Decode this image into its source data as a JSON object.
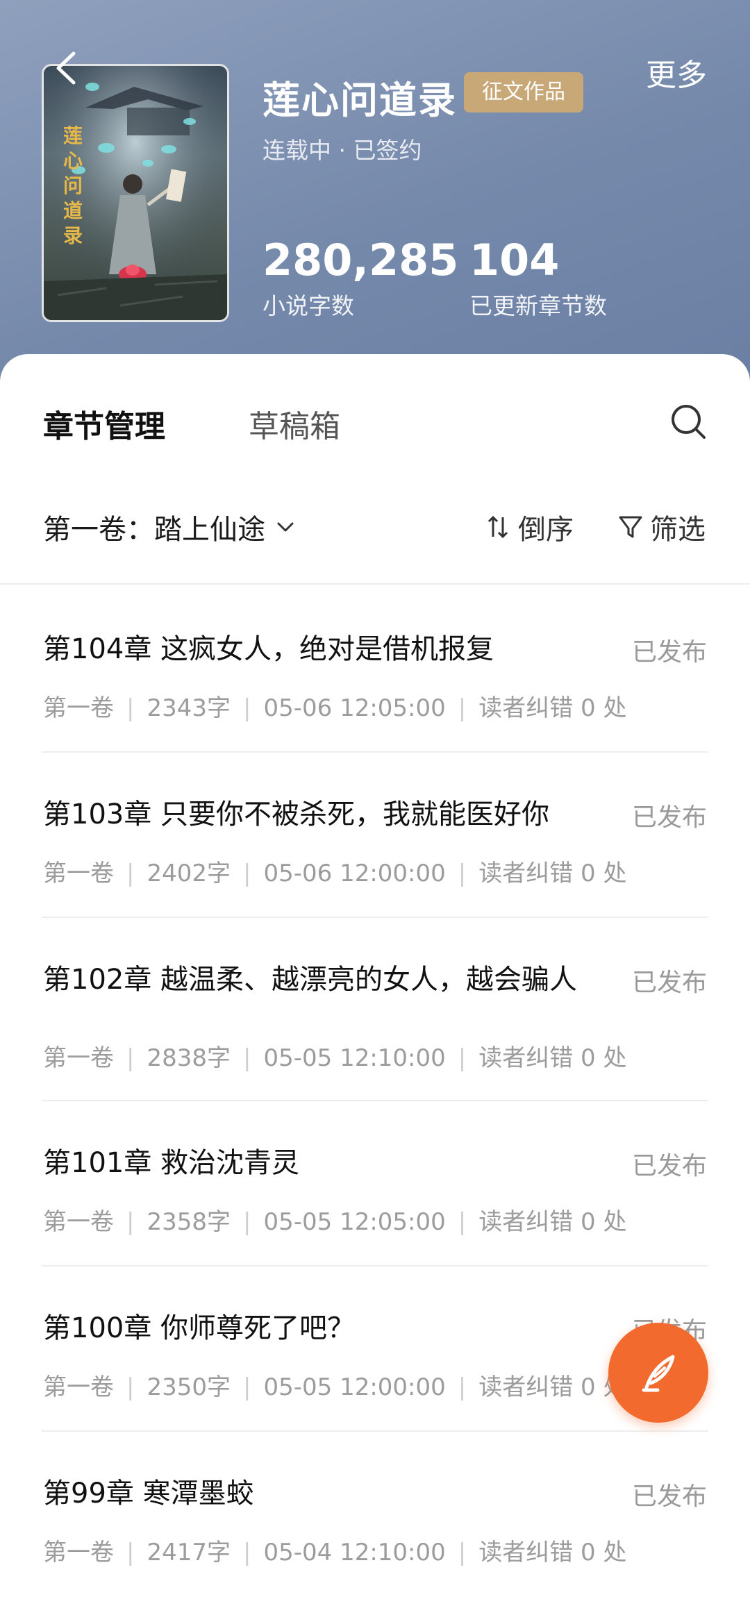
{
  "header": {
    "more_label": "更多",
    "title": "莲心问道录",
    "badge": "征文作品",
    "status": "连载中 · 已签约",
    "cover_text": "莲心问道录",
    "stats": [
      {
        "value": "280,285",
        "label": "小说字数"
      },
      {
        "value": "104",
        "label": "已更新章节数"
      }
    ]
  },
  "tabs": {
    "active": "章节管理",
    "draft": "草稿箱"
  },
  "toolbar": {
    "volume": "第一卷：踏上仙途",
    "sort": "倒序",
    "filter": "筛选"
  },
  "chapters": [
    {
      "title": "第104章 这疯女人，绝对是借机报复",
      "status": "已发布",
      "volume": "第一卷",
      "words": "2343字",
      "time": "05-06 12:05:00",
      "errata": "读者纠错 0 处"
    },
    {
      "title": "第103章 只要你不被杀死，我就能医好你",
      "status": "已发布",
      "volume": "第一卷",
      "words": "2402字",
      "time": "05-06 12:00:00",
      "errata": "读者纠错 0 处"
    },
    {
      "title": "第102章 越温柔、越漂亮的女人，越会骗人",
      "status": "已发布",
      "volume": "第一卷",
      "words": "2838字",
      "time": "05-05 12:10:00",
      "errata": "读者纠错 0 处"
    },
    {
      "title": "第101章 救治沈青灵",
      "status": "已发布",
      "volume": "第一卷",
      "words": "2358字",
      "time": "05-05 12:05:00",
      "errata": "读者纠错 0 处"
    },
    {
      "title": "第100章 你师尊死了吧？",
      "status": "已发布",
      "volume": "第一卷",
      "words": "2350字",
      "time": "05-05 12:00:00",
      "errata": "读者纠错 0 处"
    },
    {
      "title": "第99章 寒潭墨蛟",
      "status": "已发布",
      "volume": "第一卷",
      "words": "2417字",
      "time": "05-04 12:10:00",
      "errata": "读者纠错 0 处"
    }
  ],
  "colors": {
    "header_bg": "#7589ab",
    "badge_bg": "#c9a878",
    "fab_bg": "#f26a2e"
  },
  "icons": [
    "back-arrow-icon",
    "search-icon",
    "chevron-down-icon",
    "sort-icon",
    "filter-icon",
    "quill-pen-icon"
  ]
}
